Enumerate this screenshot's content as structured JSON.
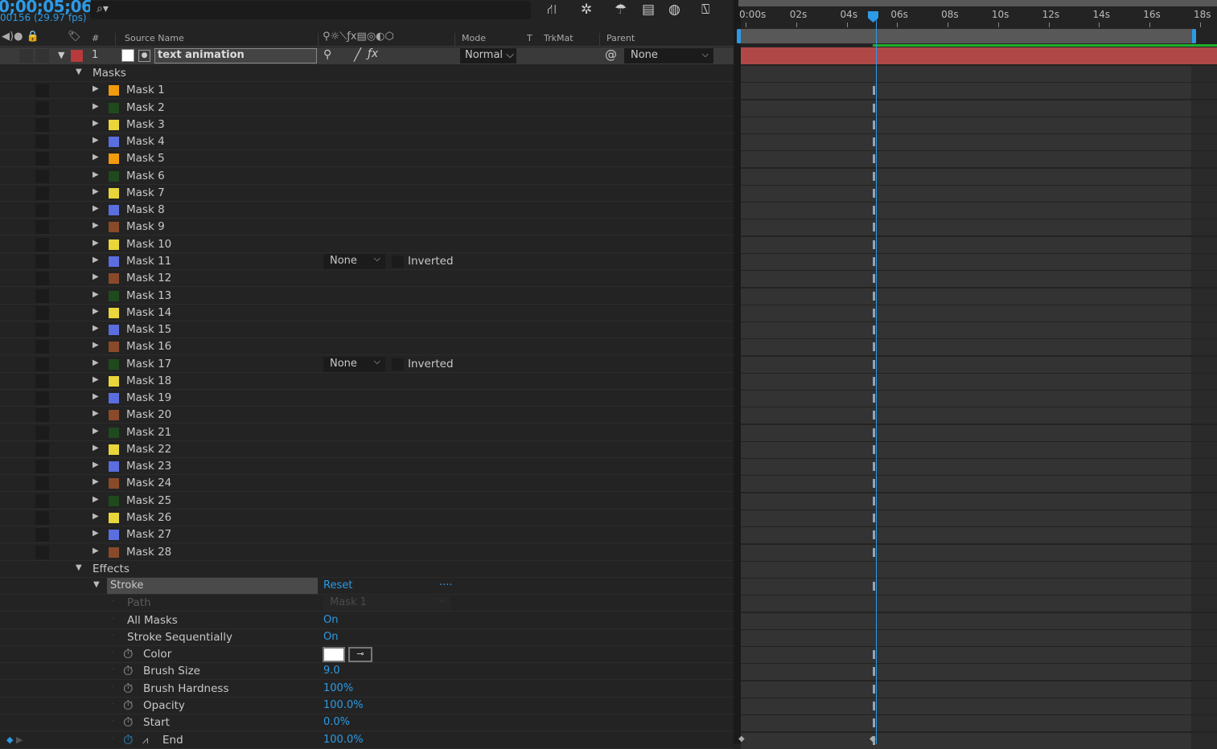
{
  "header": {
    "timecode": "0;00;05;06",
    "frames": "00156 (29.97 fps)",
    "search_icon": "search-icon"
  },
  "toolbar_icons": [
    "composition-flowchart-icon",
    "draft-3d-icon",
    "shy-layers-icon",
    "frame-blending-icon",
    "motion-blur-icon",
    "graph-editor-icon"
  ],
  "columns": {
    "number": "#",
    "source_name": "Source Name",
    "mode": "Mode",
    "t": "T",
    "trkmat": "TrkMat",
    "parent": "Parent"
  },
  "layer": {
    "number": "1",
    "name": "text animation",
    "label_color": "#b83a3a",
    "mode": "Normal",
    "parent": "None"
  },
  "masks_group": "Masks",
  "masks": [
    {
      "name": "Mask 1",
      "color": "#f29b0c"
    },
    {
      "name": "Mask 2",
      "color": "#1e4a1e"
    },
    {
      "name": "Mask 3",
      "color": "#e8d63a"
    },
    {
      "name": "Mask 4",
      "color": "#5a6ee0"
    },
    {
      "name": "Mask 5",
      "color": "#f29b0c"
    },
    {
      "name": "Mask 6",
      "color": "#1e4a1e"
    },
    {
      "name": "Mask 7",
      "color": "#e8d63a"
    },
    {
      "name": "Mask 8",
      "color": "#5a6ee0"
    },
    {
      "name": "Mask 9",
      "color": "#8a4a2a"
    },
    {
      "name": "Mask 10",
      "color": "#e8d63a"
    },
    {
      "name": "Mask 11",
      "color": "#5a6ee0",
      "mode": "None",
      "inverted": "Inverted"
    },
    {
      "name": "Mask 12",
      "color": "#8a4a2a"
    },
    {
      "name": "Mask 13",
      "color": "#1e4a1e"
    },
    {
      "name": "Mask 14",
      "color": "#e8d63a"
    },
    {
      "name": "Mask 15",
      "color": "#5a6ee0"
    },
    {
      "name": "Mask 16",
      "color": "#8a4a2a"
    },
    {
      "name": "Mask 17",
      "color": "#1e4a1e",
      "mode": "None",
      "inverted": "Inverted"
    },
    {
      "name": "Mask 18",
      "color": "#e8d63a"
    },
    {
      "name": "Mask 19",
      "color": "#5a6ee0"
    },
    {
      "name": "Mask 20",
      "color": "#8a4a2a"
    },
    {
      "name": "Mask 21",
      "color": "#1e4a1e"
    },
    {
      "name": "Mask 22",
      "color": "#e8d63a"
    },
    {
      "name": "Mask 23",
      "color": "#5a6ee0"
    },
    {
      "name": "Mask 24",
      "color": "#8a4a2a"
    },
    {
      "name": "Mask 25",
      "color": "#1e4a1e"
    },
    {
      "name": "Mask 26",
      "color": "#e8d63a"
    },
    {
      "name": "Mask 27",
      "color": "#5a6ee0"
    },
    {
      "name": "Mask 28",
      "color": "#8a4a2a"
    }
  ],
  "effects_group": "Effects",
  "stroke": {
    "name": "Stroke",
    "reset": "Reset",
    "more": "....",
    "properties": [
      {
        "name": "Path",
        "value": "Mask 1",
        "disabled": true
      },
      {
        "name": "All Masks",
        "value": "On"
      },
      {
        "name": "Stroke Sequentially",
        "value": "On"
      },
      {
        "name": "Color",
        "value": "",
        "swatch": "#ffffff",
        "stopwatch": true
      },
      {
        "name": "Brush Size",
        "value": "9.0",
        "stopwatch": true
      },
      {
        "name": "Brush Hardness",
        "value": "100%",
        "stopwatch": true
      },
      {
        "name": "Opacity",
        "value": "100.0%",
        "stopwatch": true
      },
      {
        "name": "Start",
        "value": "0.0%",
        "stopwatch": true
      },
      {
        "name": "End",
        "value": "100.0%",
        "stopwatch": true,
        "animated": true
      }
    ]
  },
  "timeline": {
    "ticks": [
      "0:00s",
      "02s",
      "04s",
      "06s",
      "08s",
      "10s",
      "12s",
      "14s",
      "16s",
      "18s"
    ],
    "current_time_s": 5.2,
    "duration_s": 18,
    "playhead_color": "#2d9ae6",
    "layer_bar_color": "#b04848"
  }
}
